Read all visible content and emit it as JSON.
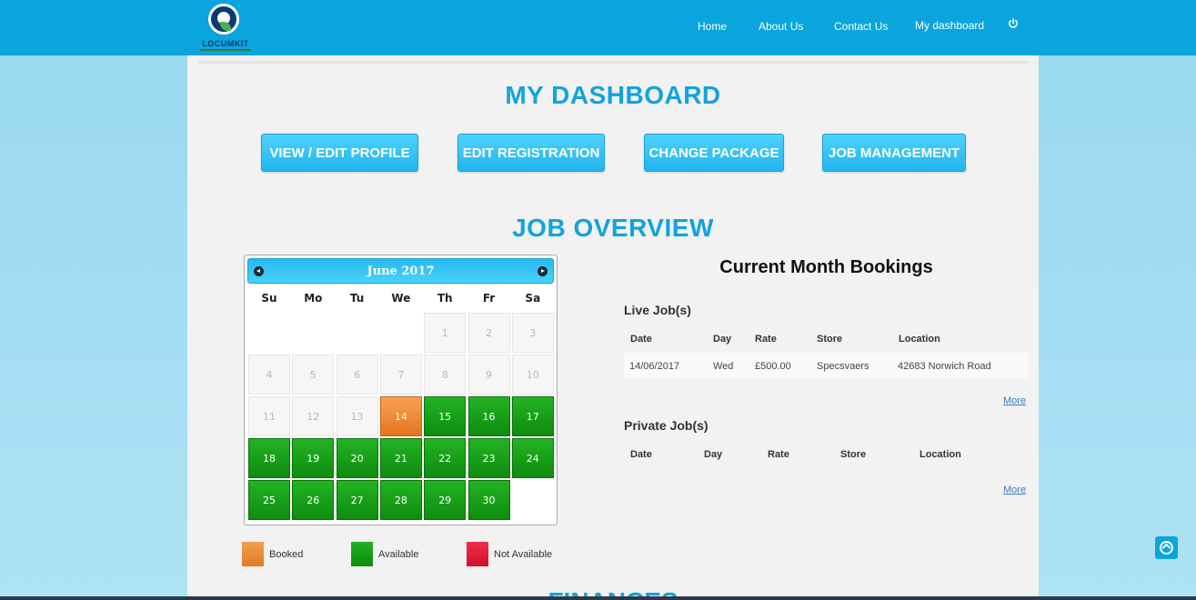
{
  "header": {
    "logo_text": "LOCUMKIT",
    "nav": [
      {
        "label": "Home"
      },
      {
        "label": "About Us"
      },
      {
        "label": "Contact Us"
      },
      {
        "label": "My dashboard"
      }
    ],
    "power_icon": "power-icon",
    "bg_color": "#0aa5dd"
  },
  "main": {
    "title": "MY DASHBOARD",
    "buttons": [
      {
        "label": "VIEW / EDIT PROFILE"
      },
      {
        "label": "EDIT REGISTRATION"
      },
      {
        "label": "CHANGE PACKAGE"
      },
      {
        "label": "JOB MANAGEMENT"
      }
    ],
    "job_overview_title": "JOB OVERVIEW",
    "finances_title": "FINANCES"
  },
  "calendar": {
    "month_label": "June 2017",
    "prev_icon": "chevron-left-icon",
    "next_icon": "chevron-right-icon",
    "weekdays": [
      "Su",
      "Mo",
      "Tu",
      "We",
      "Th",
      "Fr",
      "Sa"
    ],
    "first_weekday_index": 4,
    "days": [
      {
        "day": "1",
        "status": "na"
      },
      {
        "day": "2",
        "status": "na"
      },
      {
        "day": "3",
        "status": "na"
      },
      {
        "day": "4",
        "status": "na"
      },
      {
        "day": "5",
        "status": "na"
      },
      {
        "day": "6",
        "status": "na"
      },
      {
        "day": "7",
        "status": "na"
      },
      {
        "day": "8",
        "status": "na"
      },
      {
        "day": "9",
        "status": "na"
      },
      {
        "day": "10",
        "status": "na"
      },
      {
        "day": "11",
        "status": "na"
      },
      {
        "day": "12",
        "status": "na"
      },
      {
        "day": "13",
        "status": "na"
      },
      {
        "day": "14",
        "status": "booked"
      },
      {
        "day": "15",
        "status": "available"
      },
      {
        "day": "16",
        "status": "available"
      },
      {
        "day": "17",
        "status": "available"
      },
      {
        "day": "18",
        "status": "available"
      },
      {
        "day": "19",
        "status": "available"
      },
      {
        "day": "20",
        "status": "available"
      },
      {
        "day": "21",
        "status": "available"
      },
      {
        "day": "22",
        "status": "available"
      },
      {
        "day": "23",
        "status": "available"
      },
      {
        "day": "24",
        "status": "available"
      },
      {
        "day": "25",
        "status": "available"
      },
      {
        "day": "26",
        "status": "available"
      },
      {
        "day": "27",
        "status": "available"
      },
      {
        "day": "28",
        "status": "available"
      },
      {
        "day": "29",
        "status": "available"
      },
      {
        "day": "30",
        "status": "available"
      }
    ],
    "legend": [
      {
        "label": "Booked",
        "color": "#e98a33"
      },
      {
        "label": "Available",
        "color": "#12991a"
      },
      {
        "label": "Not Available",
        "color": "#dc1a2e"
      }
    ]
  },
  "bookings": {
    "title": "Current Month Bookings",
    "live_title": "Live Job(s)",
    "live_headers": [
      "Date",
      "Day",
      "Rate",
      "Store",
      "Location"
    ],
    "live_rows": [
      [
        "14/06/2017",
        "Wed",
        "£500.00",
        "Specsvaers",
        "42683 Norwich Road"
      ]
    ],
    "live_more": "More",
    "private_title": "Private Job(s)",
    "private_headers": [
      "Date",
      "Day",
      "Rate",
      "Store",
      "Location"
    ],
    "private_more": "More"
  },
  "scroll_top_icon": "arrow-up-circle-icon"
}
